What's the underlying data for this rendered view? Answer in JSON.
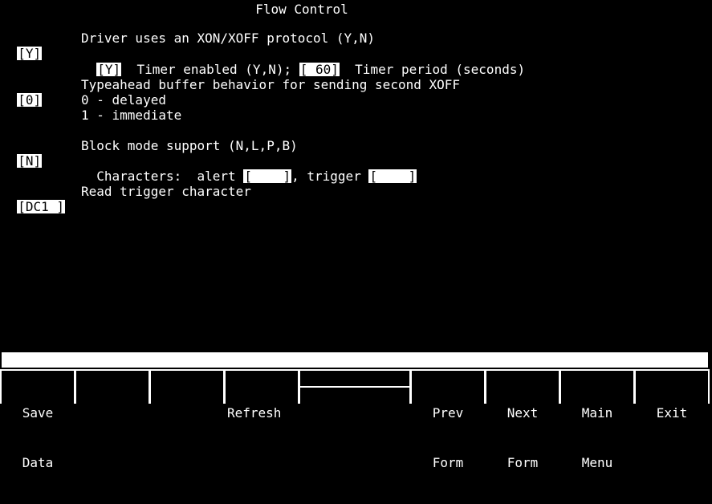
{
  "screen": {
    "title": "Flow Control"
  },
  "form": {
    "xon_xoff": {
      "value": "[Y]",
      "label": "Driver uses an XON/XOFF protocol (Y,N)"
    },
    "timer_enabled": {
      "value": "[Y]",
      "label": "Timer enabled (Y,N);"
    },
    "timer_period": {
      "value": "[ 60]",
      "label": "Timer period (seconds)"
    },
    "typeahead": {
      "value": "[0]",
      "label": "Typeahead buffer behavior for sending second XOFF",
      "options": [
        "0 - delayed",
        "1 - immediate"
      ]
    },
    "block_mode": {
      "value": "[N]",
      "label": "Block mode support (N,L,P,B)"
    },
    "characters": {
      "label": "Characters:",
      "alert_label": "alert",
      "alert_value": "[    ]",
      "separator": ",",
      "trigger_label": "trigger",
      "trigger_value": "[    ]"
    },
    "read_trigger": {
      "value": "[DC1 ]",
      "label": "Read trigger character"
    }
  },
  "status_bar": {
    "text": ""
  },
  "function_keys": [
    {
      "line1": "Save",
      "line2": "Data"
    },
    {
      "line1": "",
      "line2": ""
    },
    {
      "line1": "",
      "line2": ""
    },
    {
      "line1": "Refresh",
      "line2": ""
    },
    {
      "line1": "",
      "line2": ""
    },
    {
      "line1": "Prev",
      "line2": "Form"
    },
    {
      "line1": "Next",
      "line2": "Form"
    },
    {
      "line1": "Main",
      "line2": "Menu"
    },
    {
      "line1": "Exit",
      "line2": ""
    }
  ]
}
